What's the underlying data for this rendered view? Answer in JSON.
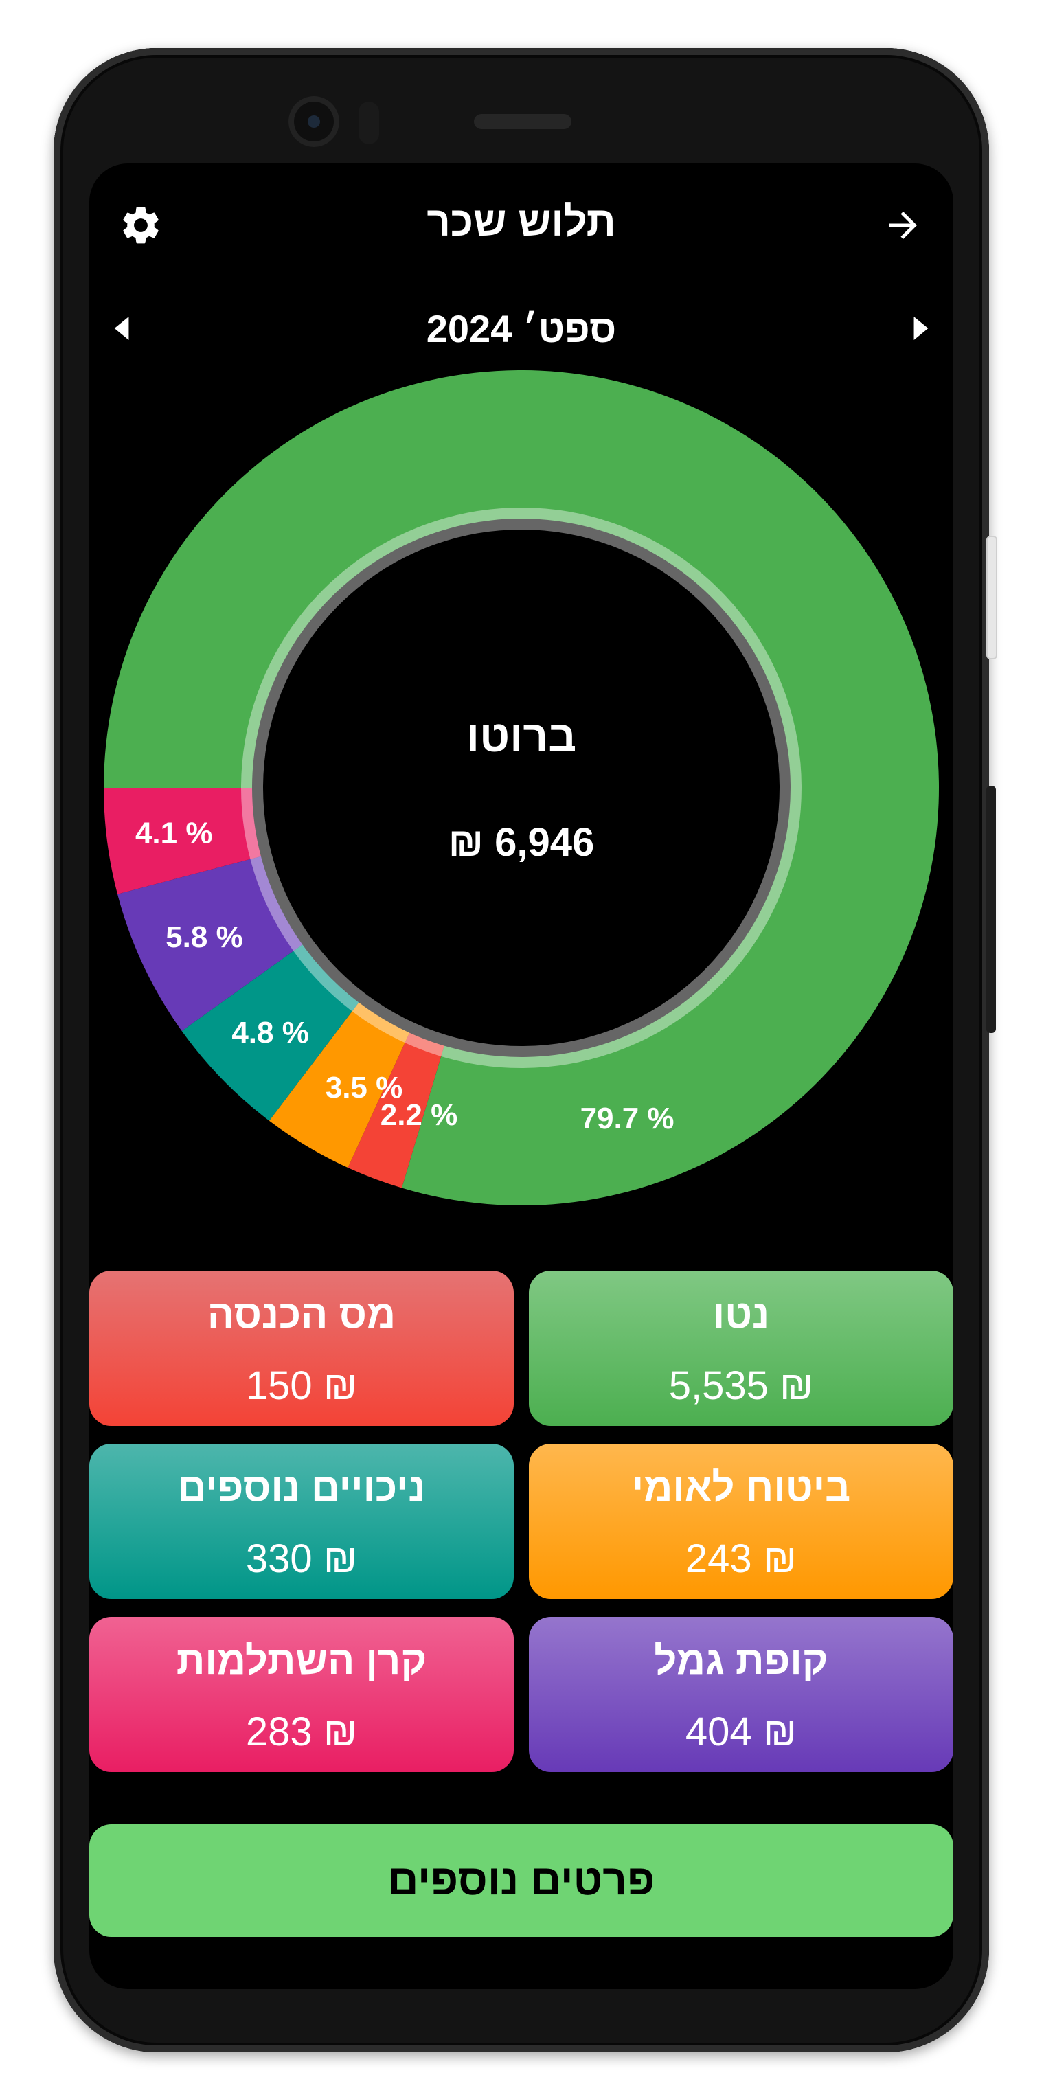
{
  "app": {
    "title": "תלוש שכר",
    "icons": {
      "settings": "gear-icon",
      "back": "arrow-right-icon"
    }
  },
  "period": {
    "label": "ספט׳ 2024",
    "icons": {
      "prev": "triangle-left-icon",
      "next": "triangle-right-icon"
    }
  },
  "chart_data": {
    "type": "pie",
    "title": "ברוטו",
    "total_value": "₪ 6,946",
    "slices": [
      {
        "key": "net",
        "value": 79.7,
        "label": "79.7 %",
        "color": "#4caf50"
      },
      {
        "key": "income_tax",
        "value": 2.2,
        "label": "2.2 %",
        "color": "#f44336"
      },
      {
        "key": "national_insurance",
        "value": 3.5,
        "label": "3.5 %",
        "color": "#ff9800"
      },
      {
        "key": "extra_deductions",
        "value": 4.8,
        "label": "4.8 %",
        "color": "#009688"
      },
      {
        "key": "provident_fund",
        "value": 5.8,
        "label": "5.8 %",
        "color": "#673ab7"
      },
      {
        "key": "study_fund",
        "value": 4.1,
        "label": "4.1 %",
        "color": "#e91e63"
      }
    ]
  },
  "cards": [
    {
      "key": "net",
      "label": "נטו",
      "value": "₪ 5,535",
      "color_top": "#80c883",
      "color_bottom": "#4caf50"
    },
    {
      "key": "income_tax",
      "label": "מס הכנסה",
      "value": "₪ 150",
      "color_top": "#e57373",
      "color_bottom": "#f44336"
    },
    {
      "key": "national_insurance",
      "label": "ביטוח לאומי",
      "value": "₪ 243",
      "color_top": "#ffb74d",
      "color_bottom": "#ff9800"
    },
    {
      "key": "extra_deductions",
      "label": "ניכויים נוספים",
      "value": "₪ 330",
      "color_top": "#4db6ac",
      "color_bottom": "#009688"
    },
    {
      "key": "provident_fund",
      "label": "קופת גמל",
      "value": "₪ 404",
      "color_top": "#9575cd",
      "color_bottom": "#673ab7"
    },
    {
      "key": "study_fund",
      "label": "קרן השתלמות",
      "value": "₪ 283",
      "color_top": "#f06292",
      "color_bottom": "#e91e63"
    }
  ],
  "more_button": {
    "label": "פרטים נוספים",
    "color": "#6fd473"
  }
}
